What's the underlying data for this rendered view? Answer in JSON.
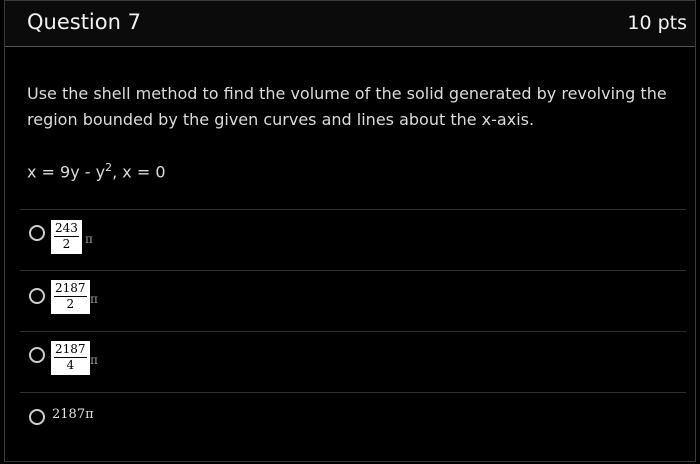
{
  "question": {
    "title": "Question 7",
    "points": "10 pts",
    "prompt": "Use the shell method to find the volume of the solid generated by revolving the region bounded by the given curves and lines about the x-axis.",
    "equation": {
      "before_exponent": "x = 9y - y",
      "exponent": "2",
      "after_exponent": ", x = 0"
    }
  },
  "answers": [
    {
      "numerator": "243",
      "denominator": "2",
      "suffix": "π"
    },
    {
      "numerator": "2187",
      "denominator": "2",
      "suffix": "π"
    },
    {
      "numerator": "2187",
      "denominator": "4",
      "suffix": "π"
    },
    {
      "text": "2187π"
    }
  ]
}
